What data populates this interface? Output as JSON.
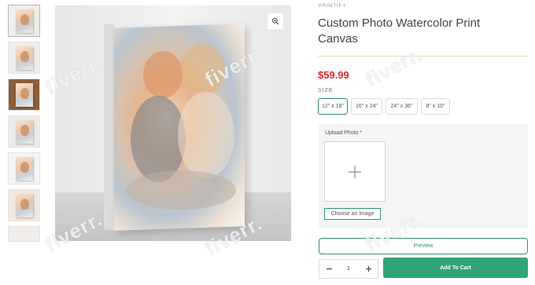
{
  "thumbnails": [
    {
      "name": "thumb-1"
    },
    {
      "name": "thumb-2"
    },
    {
      "name": "thumb-3"
    },
    {
      "name": "thumb-4"
    },
    {
      "name": "thumb-5"
    },
    {
      "name": "thumb-6"
    },
    {
      "name": "thumb-7"
    }
  ],
  "product": {
    "vendor": "PRINTIFY",
    "title": "Custom Photo Watercolor Print Canvas",
    "price": "$59.99"
  },
  "size": {
    "label": "SIZE",
    "options": [
      "12\" x 18\"",
      "16\" x 24\"",
      "24\" x 36\"",
      "8\" x 10\""
    ],
    "selected": "12\" x 18\""
  },
  "upload": {
    "label": "Upload Photo",
    "required_mark": "*",
    "choose_label": "Choose an image"
  },
  "actions": {
    "preview_label": "Preview",
    "quantity": "1",
    "add_to_cart_label": "Add To Cart"
  },
  "icons": {
    "zoom": "zoom-in-icon",
    "plus": "plus-icon",
    "minus": "minus-icon"
  },
  "watermark": "fiverr.",
  "colors": {
    "accent": "#31a477",
    "price": "#e2262d",
    "divider": "#e3d8b8"
  }
}
